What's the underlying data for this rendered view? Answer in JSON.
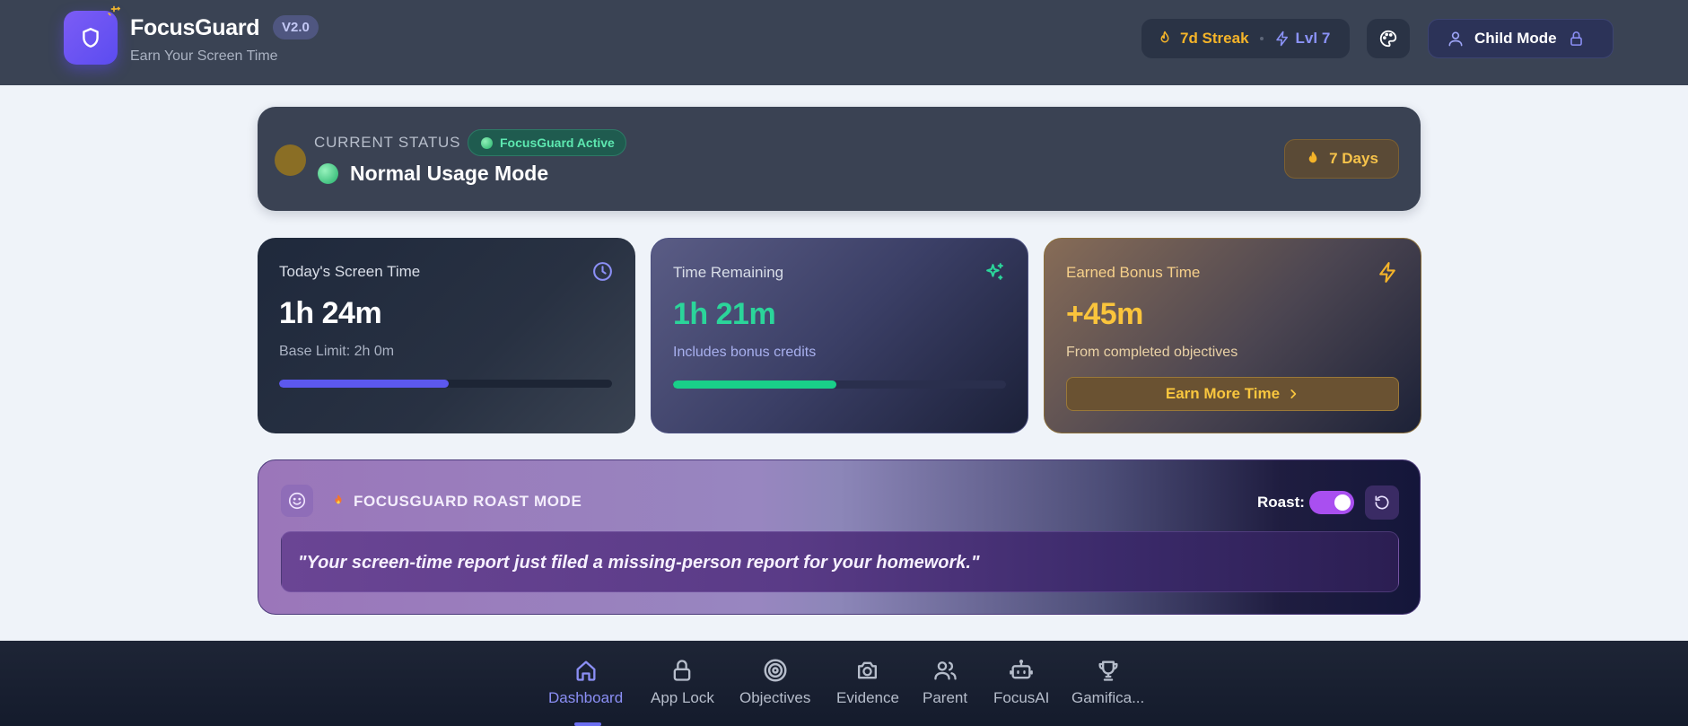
{
  "header": {
    "app_title": "FocusGuard",
    "version": "V2.0",
    "subtitle": "Earn Your Screen Time",
    "streak": "7d Streak",
    "level": "Lvl 7",
    "child_mode_label": "Child Mode"
  },
  "status": {
    "label": "CURRENT STATUS",
    "active_badge": "FocusGuard Active",
    "mode": "Normal Usage Mode",
    "days": "7 Days"
  },
  "cards": {
    "screen_time": {
      "title": "Today's Screen Time",
      "value": "1h 24m",
      "sub": "Base Limit: 2h 0m",
      "progress": 0.51
    },
    "remaining": {
      "title": "Time Remaining",
      "value": "1h 21m",
      "sub": "Includes bonus credits",
      "progress": 0.49
    },
    "bonus": {
      "title": "Earned Bonus Time",
      "value": "+45m",
      "sub": "From completed objectives",
      "button": "Earn More Time"
    }
  },
  "roast": {
    "title": "FOCUSGUARD ROAST MODE",
    "toggle_label": "Roast:",
    "toggle_on": true,
    "quote": "\"Your screen-time report just filed a missing-person report for your homework.\""
  },
  "nav": {
    "items": [
      {
        "label": "Dashboard",
        "icon": "home-icon",
        "active": true
      },
      {
        "label": "App Lock",
        "icon": "lock-icon",
        "active": false
      },
      {
        "label": "Objectives",
        "icon": "target-icon",
        "active": false
      },
      {
        "label": "Evidence",
        "icon": "camera-icon",
        "active": false
      },
      {
        "label": "Parent",
        "icon": "users-icon",
        "active": false
      },
      {
        "label": "FocusAI",
        "icon": "bot-icon",
        "active": false
      },
      {
        "label": "Gamifica...",
        "icon": "trophy-icon",
        "active": false
      }
    ]
  },
  "colors": {
    "accent": "#6b6ff0",
    "success": "#2bd59a",
    "warning": "#fac43c",
    "header_bg": "#3a4354"
  }
}
